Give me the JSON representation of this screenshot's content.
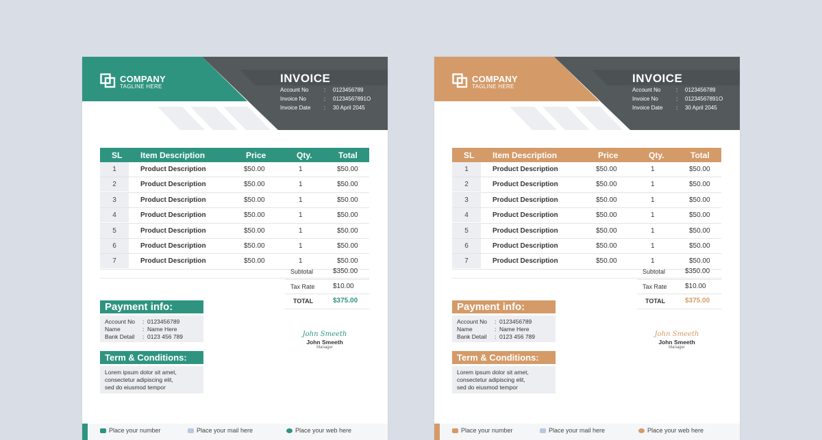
{
  "invoices": [
    {
      "theme": {
        "accent": "#2e9480",
        "dark": "#545a5c",
        "stripes": "#eceef1"
      },
      "company": {
        "name": "COMPANY",
        "tagline": "TAGLINE HERE"
      },
      "title": "INVOICE",
      "meta": [
        {
          "label": "Account No",
          "value": "0123456789"
        },
        {
          "label": "Invoice No",
          "value": "01234567891O"
        },
        {
          "label": "Invoice Date",
          "value": "30 April 2045"
        }
      ],
      "table": {
        "headers": {
          "sl": "SL",
          "desc": "Item Description",
          "price": "Price",
          "qty": "Qty.",
          "total": "Total"
        },
        "rows": [
          {
            "sl": "1",
            "desc": "Product Description",
            "price": "$50.00",
            "qty": "1",
            "total": "$50.00"
          },
          {
            "sl": "2",
            "desc": "Product Description",
            "price": "$50.00",
            "qty": "1",
            "total": "$50.00"
          },
          {
            "sl": "3",
            "desc": "Product Description",
            "price": "$50.00",
            "qty": "1",
            "total": "$50.00"
          },
          {
            "sl": "4",
            "desc": "Product Description",
            "price": "$50.00",
            "qty": "1",
            "total": "$50.00"
          },
          {
            "sl": "5",
            "desc": "Product Description",
            "price": "$50.00",
            "qty": "1",
            "total": "$50.00"
          },
          {
            "sl": "6",
            "desc": "Product Description",
            "price": "$50.00",
            "qty": "1",
            "total": "$50.00"
          },
          {
            "sl": "7",
            "desc": "Product Description",
            "price": "$50.00",
            "qty": "1",
            "total": "$50.00"
          }
        ]
      },
      "summary": {
        "subtotal_label": "Subtotal",
        "subtotal": "$350.00",
        "tax_label": "Tax Rate",
        "tax": "$10.00",
        "total_label": "TOTAL",
        "total": "$375.00"
      },
      "payment": {
        "heading": "Payment info:",
        "rows": [
          {
            "label": "Account No",
            "value": "0123456789"
          },
          {
            "label": "Name",
            "value": "Name Here"
          },
          {
            "label": "Bank Detail",
            "value": "0123 456 789"
          }
        ]
      },
      "terms": {
        "heading": "Term & Conditions:",
        "lines": [
          "Lorem ipsum dolor sit amet,",
          "consectetur adipiscing elit,",
          "sed do eiusmod tempor"
        ]
      },
      "signature": {
        "script": "John Smeeth",
        "name": "John Smeeth",
        "role": "Manager"
      },
      "footer": {
        "phone": "Place your number",
        "mail": "Place your mail here",
        "web": "Place your web here"
      }
    },
    {
      "theme": {
        "accent": "#d49a68",
        "dark": "#545a5c",
        "stripes": "#eceef1"
      },
      "company": {
        "name": "COMPANY",
        "tagline": "TAGLINE HERE"
      },
      "title": "INVOICE",
      "meta": [
        {
          "label": "Account No",
          "value": "0123456789"
        },
        {
          "label": "Invoice No",
          "value": "01234567891O"
        },
        {
          "label": "Invoice Date",
          "value": "30 April 2045"
        }
      ],
      "table": {
        "headers": {
          "sl": "SL",
          "desc": "Item Description",
          "price": "Price",
          "qty": "Qty.",
          "total": "Total"
        },
        "rows": [
          {
            "sl": "1",
            "desc": "Product Description",
            "price": "$50.00",
            "qty": "1",
            "total": "$50.00"
          },
          {
            "sl": "2",
            "desc": "Product Description",
            "price": "$50.00",
            "qty": "1",
            "total": "$50.00"
          },
          {
            "sl": "3",
            "desc": "Product Description",
            "price": "$50.00",
            "qty": "1",
            "total": "$50.00"
          },
          {
            "sl": "4",
            "desc": "Product Description",
            "price": "$50.00",
            "qty": "1",
            "total": "$50.00"
          },
          {
            "sl": "5",
            "desc": "Product Description",
            "price": "$50.00",
            "qty": "1",
            "total": "$50.00"
          },
          {
            "sl": "6",
            "desc": "Product Description",
            "price": "$50.00",
            "qty": "1",
            "total": "$50.00"
          },
          {
            "sl": "7",
            "desc": "Product Description",
            "price": "$50.00",
            "qty": "1",
            "total": "$50.00"
          }
        ]
      },
      "summary": {
        "subtotal_label": "Subtotal",
        "subtotal": "$350.00",
        "tax_label": "Tax Rate",
        "tax": "$10.00",
        "total_label": "TOTAL",
        "total": "$375.00"
      },
      "payment": {
        "heading": "Payment info:",
        "rows": [
          {
            "label": "Account No",
            "value": "0123456789"
          },
          {
            "label": "Name",
            "value": "Name Here"
          },
          {
            "label": "Bank Detail",
            "value": "0123 456 789"
          }
        ]
      },
      "terms": {
        "heading": "Term & Conditions:",
        "lines": [
          "Lorem ipsum dolor sit amet,",
          "consectetur adipiscing elit,",
          "sed do eiusmod tempor"
        ]
      },
      "signature": {
        "script": "John Smeeth",
        "name": "John Smeeth",
        "role": "Manager"
      },
      "footer": {
        "phone": "Place your number",
        "mail": "Place your mail here",
        "web": "Place your web here"
      }
    }
  ]
}
